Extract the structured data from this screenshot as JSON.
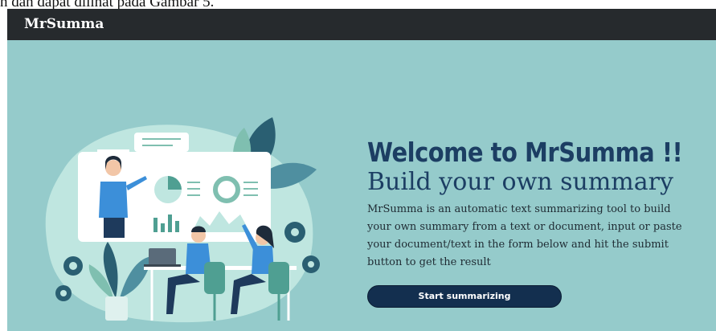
{
  "caption": "n dan dapat dilihat pada Gambar 5.",
  "navbar": {
    "brand": "MrSumma"
  },
  "hero": {
    "headline": "Welcome to MrSumma !!",
    "subheadline": "Build your own summary",
    "description": "MrSumma is an automatic text summarizing tool to build your own summary from a text or document, input or paste your document/text in the form below and hit the submit button to get the result",
    "cta_label": "Start summarizing",
    "illustration": "team-collaboration-illustration"
  },
  "colors": {
    "background": "#95cbcb",
    "navbar": "#262a2d",
    "heading": "#1c3e63",
    "button": "#132f4f"
  }
}
